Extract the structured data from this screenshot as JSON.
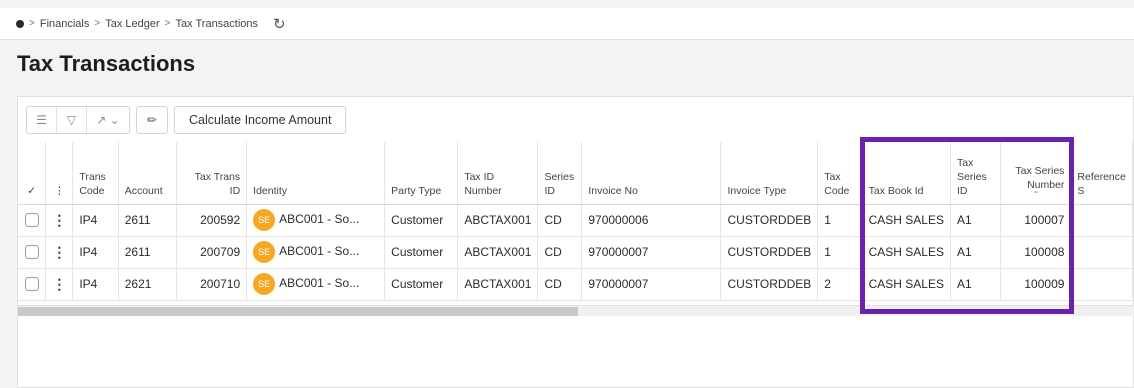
{
  "breadcrumb": {
    "items": [
      "Financials",
      "Tax Ledger",
      "Tax Transactions"
    ]
  },
  "page_title": "Tax Transactions",
  "toolbar": {
    "calculate_label": "Calculate Income Amount"
  },
  "columns": {
    "trans_code": "Trans Code",
    "account": "Account",
    "tax_trans_id": "Tax Trans ID",
    "identity": "Identity",
    "party_type": "Party Type",
    "tax_id_number": "Tax ID Number",
    "series_id": "Series ID",
    "invoice_no": "Invoice No",
    "invoice_type": "Invoice Type",
    "tax_code": "Tax Code",
    "tax_book_id": "Tax Book Id",
    "tax_series_id": "Tax Series ID",
    "tax_series_number": "Tax Series Number",
    "reference": "Reference S"
  },
  "rows": [
    {
      "trans_code": "IP4",
      "account": "2611",
      "tax_trans_id": "200592",
      "identity_badge": "SE",
      "identity": "ABC001 - So...",
      "party_type": "Customer",
      "tax_id_number": "ABCTAX001",
      "series_id": "CD",
      "invoice_no": "970000006",
      "invoice_type": "CUSTORDDEB",
      "tax_code": "1",
      "tax_book_id": "CASH SALES",
      "tax_series_id": "A1",
      "tax_series_number": "100007"
    },
    {
      "trans_code": "IP4",
      "account": "2611",
      "tax_trans_id": "200709",
      "identity_badge": "SE",
      "identity": "ABC001 - So...",
      "party_type": "Customer",
      "tax_id_number": "ABCTAX001",
      "series_id": "CD",
      "invoice_no": "970000007",
      "invoice_type": "CUSTORDDEB",
      "tax_code": "1",
      "tax_book_id": "CASH SALES",
      "tax_series_id": "A1",
      "tax_series_number": "100008"
    },
    {
      "trans_code": "IP4",
      "account": "2621",
      "tax_trans_id": "200710",
      "identity_badge": "SE",
      "identity": "ABC001 - So...",
      "party_type": "Customer",
      "tax_id_number": "ABCTAX001",
      "series_id": "CD",
      "invoice_no": "970000007",
      "invoice_type": "CUSTORDDEB",
      "tax_code": "2",
      "tax_book_id": "CASH SALES",
      "tax_series_id": "A1",
      "tax_series_number": "100009"
    }
  ],
  "colors": {
    "highlight": "#6a23a8",
    "badge": "#f5a623"
  }
}
